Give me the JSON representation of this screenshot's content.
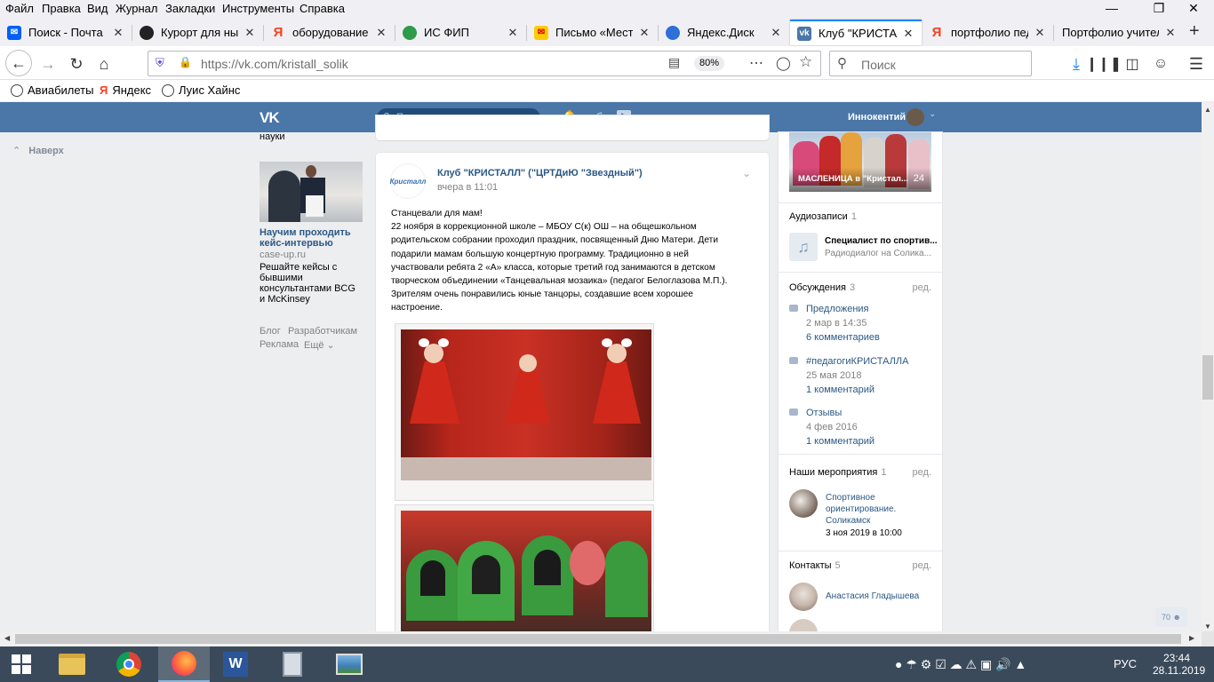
{
  "menubar": {
    "items": [
      "Файл",
      "Правка",
      "Вид",
      "Журнал",
      "Закладки",
      "Инструменты",
      "Справка"
    ]
  },
  "tabs": [
    {
      "label": "Поиск - Почта Mail.ru",
      "favicon_color": "#005ff9"
    },
    {
      "label": "Курорт для ныр",
      "favicon_color": "#222222"
    },
    {
      "label": "оборудование для",
      "favicon_color": "#fc3f1d"
    },
    {
      "label": "ИС ФИП",
      "favicon_color": "#2e9b4a"
    },
    {
      "label": "Письмо «Место",
      "favicon_color": "#ffcc00"
    },
    {
      "label": "Яндекс.Диск",
      "favicon_color": "#2f6fd8"
    },
    {
      "label": "Клуб \"КРИСТАЛЛ\"",
      "favicon_color": "#4a76a8"
    },
    {
      "label": "портфолио педагога",
      "favicon_color": "#fc3f1d"
    },
    {
      "label": "Портфолио учителя",
      "favicon_color": ""
    }
  ],
  "nav": {
    "url_host": "https://vk.com/",
    "url_path": "kristall_solik",
    "zoom": "80%",
    "search_placeholder": "Поиск"
  },
  "bookmarks": [
    "Авиабилеты",
    "Яндекс",
    "Луис Хайнс"
  ],
  "vk_header": {
    "search_placeholder": "Поиск",
    "user_name": "Иннокентий"
  },
  "left_col": {
    "back_top": "Наверх",
    "prev_ad_text": "науки",
    "ad": {
      "title": "Научим проходить кейс-интервью",
      "domain": "case-up.ru",
      "text": "Решайте кейсы с бывшими консультантами BCG и McKinsey"
    },
    "footer_links": [
      "Блог",
      "Разработчикам",
      "Реклама",
      "Ещё ⌄"
    ]
  },
  "post": {
    "author": "Клуб \"КРИСТАЛЛ\" (\"ЦРТДиЮ \"Звездный\")",
    "time": "вчера в 11:01",
    "avatar_text": "Кристалл",
    "text_lines": [
      "Станцевали для мам!",
      "22 ноября в коррекционной школе – МБОУ С(к) ОШ – на общешкольном",
      "родительском собрании проходил праздник, посвященный Дню Матери. Дети",
      "подарили мамам большую концертную программу. Традиционно в ней",
      "участвовали ребята 2 «А» класса, которые третий год занимаются в детском",
      "творческом объединении «Танцевальная мозаика» (педагог Белоглазова М.П.).",
      "Зрителям очень понравились юные танцоры, создавшие всем хорошее",
      "настроение."
    ]
  },
  "right_col": {
    "album_caption": "МАСЛЕНИЦА в \"Кристал...",
    "album_count": "24",
    "audio": {
      "title": "Аудиозаписи",
      "count": "1",
      "track": "Специалист по спортив...",
      "artist": "Радиодиалог на Солика..."
    },
    "discussions": {
      "title": "Обсуждения",
      "count": "3",
      "edit": "ред.",
      "items": [
        {
          "title": "Предложения",
          "date": "2 мар в 14:35",
          "comments": "6 комментариев"
        },
        {
          "title": "#педагогиКРИСТАЛЛА",
          "date": "25 мая 2018",
          "comments": "1 комментарий"
        },
        {
          "title": "Отзывы",
          "date": "4 фев 2016",
          "comments": "1 комментарий"
        }
      ]
    },
    "events": {
      "title": "Наши мероприятия",
      "count": "1",
      "edit": "ред.",
      "name_lines": [
        "Спортивное",
        "ориентирование.",
        "Соликамск"
      ],
      "date": "3 ноя 2019 в 10:00"
    },
    "contacts": {
      "title": "Контакты",
      "count": "5",
      "edit": "ред.",
      "first": "Анастасия Гладышева"
    },
    "online_count": "70"
  },
  "taskbar": {
    "lang": "РУС",
    "time": "23:44",
    "date": "28.11.2019"
  }
}
